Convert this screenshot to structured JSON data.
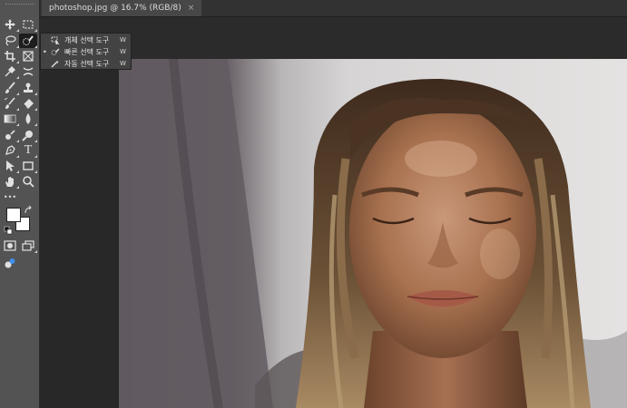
{
  "document_tab": {
    "title": "photoshop.jpg @ 16.7% (RGB/8)",
    "close_glyph": "×"
  },
  "tool_flyout": {
    "items": [
      {
        "label": "개체 선택 도구",
        "shortcut": "W",
        "icon": "object-selection-icon",
        "selected": false
      },
      {
        "label": "빠른 선택 도구",
        "shortcut": "W",
        "icon": "quick-selection-icon",
        "selected": true
      },
      {
        "label": "자동 선택 도구",
        "shortcut": "W",
        "icon": "magic-wand-icon",
        "selected": false
      }
    ],
    "selected_marker": "•"
  },
  "toolbar": {
    "tools": [
      "move-tool",
      "marquee-tool",
      "lasso-tool",
      "quick-selection-tool",
      "crop-tool",
      "frame-tool",
      "eyedropper-tool",
      "spot-healing-tool",
      "brush-tool",
      "clone-stamp-tool",
      "history-brush-tool",
      "eraser-tool",
      "gradient-tool",
      "blur-tool",
      "dodge-tool",
      "zoom-in-tool",
      "pen-tool",
      "type-tool",
      "path-selection-tool",
      "rectangle-tool",
      "hand-tool",
      "zoom-tool",
      "edit-toolbar",
      "foreground-color",
      "background-color",
      "quick-mask-mode",
      "screen-mode",
      "share-icon"
    ],
    "type_tool_glyph": "T",
    "more_glyph": "•••",
    "foreground_color": "#ffffff",
    "background_color": "#ffffff"
  },
  "colors": {
    "ui_panel": "#535353",
    "ui_dark": "#282828",
    "tab_active": "#474747"
  }
}
